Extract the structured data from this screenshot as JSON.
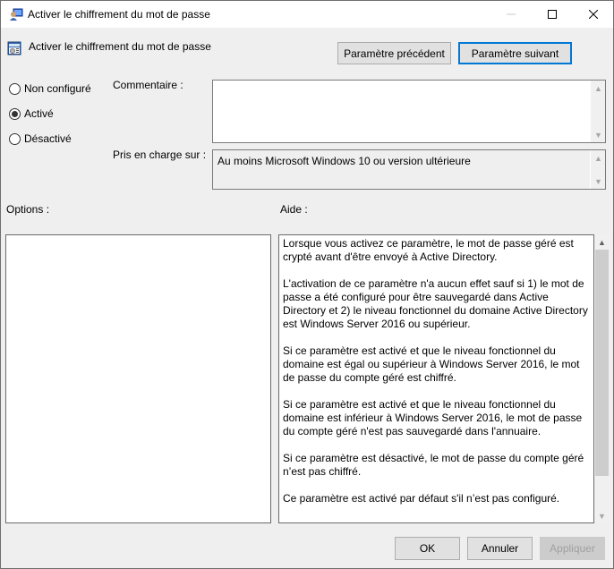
{
  "window": {
    "title": "Activer le chiffrement du mot de passe",
    "controls": {
      "minimize": "minimize",
      "maximize": "maximize",
      "close": "close"
    }
  },
  "header": {
    "setting_title": "Activer le chiffrement du mot de passe",
    "prev_button": "Paramètre précédent",
    "next_button": "Paramètre suivant"
  },
  "state": {
    "options": [
      {
        "label": "Non configuré",
        "selected": false
      },
      {
        "label": "Activé",
        "selected": true
      },
      {
        "label": "Désactivé",
        "selected": false
      }
    ]
  },
  "comment": {
    "label": "Commentaire :",
    "value": ""
  },
  "supported": {
    "label": "Pris en charge sur :",
    "value": "Au moins Microsoft Windows 10 ou version ultérieure"
  },
  "options_panel": {
    "label": "Options :"
  },
  "help_panel": {
    "label": "Aide :",
    "paragraphs": [
      "Lorsque vous activez ce paramètre, le mot de passe géré est crypté avant d'être envoyé à Active Directory.",
      "L'activation de ce paramètre n'a aucun effet sauf si 1) le mot de passe a été configuré pour être sauvegardé dans Active Directory et 2) le niveau fonctionnel du domaine Active Directory est Windows Server 2016 ou supérieur.",
      "Si ce paramètre est activé et que le niveau fonctionnel du domaine est égal ou supérieur à Windows Server 2016, le mot de passe du compte géré est chiffré.",
      "Si ce paramètre est activé et que le niveau fonctionnel du domaine est inférieur à Windows Server 2016, le mot de passe du compte géré n'est pas sauvegardé dans l'annuaire.",
      "Si ce paramètre est désactivé, le mot de passe du compte géré n’est pas chiffré.",
      "Ce paramètre est activé par défaut s'il n’est pas configuré."
    ]
  },
  "footer": {
    "ok": "OK",
    "cancel": "Annuler",
    "apply": "Appliquer"
  },
  "colors": {
    "accent": "#0078d7",
    "background": "#efefef"
  }
}
